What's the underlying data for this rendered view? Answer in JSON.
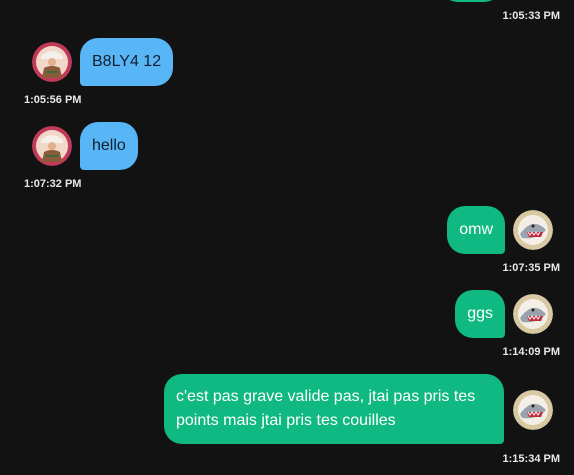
{
  "colors": {
    "background": "#121212",
    "incoming_bubble": "#58b6f6",
    "outgoing_bubble": "#10b981",
    "timestamp": "#e8e8e8"
  },
  "messages": [
    {
      "direction": "outgoing",
      "text": "",
      "time": "1:05:33 PM"
    },
    {
      "direction": "incoming",
      "text": "B8LY4 12",
      "time": "1:05:56 PM",
      "avatar": "character-avatar-icon"
    },
    {
      "direction": "incoming",
      "text": "hello",
      "time": "1:07:32 PM",
      "avatar": "character-avatar-icon"
    },
    {
      "direction": "outgoing",
      "text": "omw",
      "time": "1:07:35 PM",
      "avatar": "shark-badge-avatar-icon"
    },
    {
      "direction": "outgoing",
      "text": "ggs",
      "time": "1:14:09 PM",
      "avatar": "shark-badge-avatar-icon"
    },
    {
      "direction": "outgoing",
      "text": "c'est pas grave valide pas, jtai pas pris tes points mais jtai pris tes couilles",
      "time": "1:15:34 PM",
      "avatar": "shark-badge-avatar-icon"
    }
  ]
}
